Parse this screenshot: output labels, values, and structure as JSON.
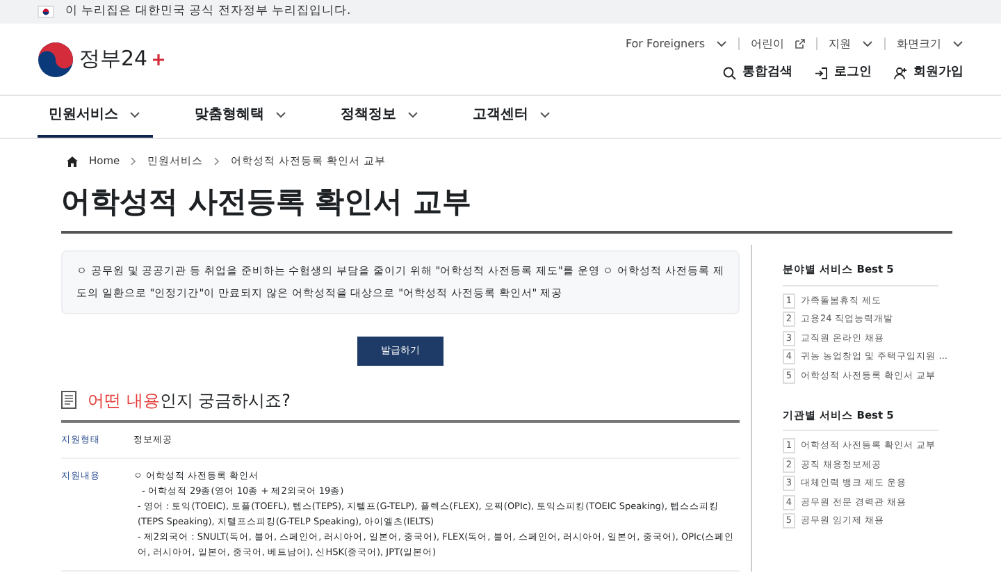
{
  "banner": {
    "text": "이 누리집은 대한민국 공식 전자정부 누리집입니다."
  },
  "header": {
    "logo_text": "정부24",
    "util_links": [
      {
        "label": "For Foreigners",
        "kind": "dropdown"
      },
      {
        "label": "어린이",
        "kind": "external"
      },
      {
        "label": "지원",
        "kind": "dropdown"
      },
      {
        "label": "화면크기",
        "kind": "dropdown"
      }
    ],
    "actions": [
      {
        "label": "통합검색",
        "kind": "search"
      },
      {
        "label": "로그인",
        "kind": "login"
      },
      {
        "label": "회원가입",
        "kind": "join"
      }
    ]
  },
  "nav": [
    {
      "label": "민원서비스",
      "selected": true
    },
    {
      "label": "맞춤형혜택",
      "selected": false
    },
    {
      "label": "정책정보",
      "selected": false
    },
    {
      "label": "고객센터",
      "selected": false
    }
  ],
  "breadcrumb": [
    "Home",
    "민원서비스",
    "어학성적 사전등록 확인서 교부"
  ],
  "title": "어학성적 사전등록 확인서 교부",
  "intro": "ㅇ 공무원 및 공공기관 등 취업을 준비하는 수험생의 부담을 줄이기 위해 \"어학성적 사전등록 제도\"를 운영 ㅇ 어학성적 사전등록 제도의 일환으로 \"인정기간\"이 만료되지 않은 어학성적을 대상으로 \"어학성적 사전등록 확인서\" 제공",
  "apply_button": "발급하기",
  "section": {
    "highlight": "어떤 내용",
    "rest": "인지 궁금하시죠?",
    "rows": [
      {
        "label": "지원형태",
        "lines": [
          {
            "kind": "main",
            "text": "정보제공"
          }
        ]
      },
      {
        "label": "지원내용",
        "lines": [
          {
            "kind": "main",
            "text": "ㅇ 어학성적 사전등록 확인서"
          },
          {
            "kind": "sub",
            "text": "- 어학성적 29종(영어 10종 + 제2외국어 19종)"
          },
          {
            "kind": "item",
            "text": "- 영어 : 토익(TOEIC), 토플(TOEFL), 텝스(TEPS), 지텔프(G-TELP), 플렉스(FLEX), 오픽(OPIc), 토익스피킹(TOEIC Speaking), 텝스스피킹(TEPS Speaking), 지텔프스피킹(G-TELP Speaking), 아이엘츠(IELTS)"
          },
          {
            "kind": "item",
            "text": "- 제2외국어 : SNULT(독어, 불어, 스페인어, 러시아어, 일본어, 중국어), FLEX(독어, 불어, 스페인어, 러시아어, 일본어, 중국어), OPIc(스페인어, 러시아어, 일본어, 중국어, 베트남어), 신HSK(중국어), JPT(일본어)"
          }
        ]
      }
    ]
  },
  "sidebar": [
    {
      "title": "분야별 서비스 Best 5",
      "items": [
        {
          "rank": "1",
          "label": "가족돌봄휴직 제도"
        },
        {
          "rank": "2",
          "label": "고용24 직업능력개발"
        },
        {
          "rank": "3",
          "label": "교직원 온라인 채용"
        },
        {
          "rank": "4",
          "label": "귀농 농업창업 및 주택구입지원 ..."
        },
        {
          "rank": "5",
          "label": "어학성적 사전등록 확인서 교부"
        }
      ]
    },
    {
      "title": "기관별 서비스 Best 5",
      "items": [
        {
          "rank": "1",
          "label": "어학성적 사전등록 확인서 교부"
        },
        {
          "rank": "2",
          "label": "공직 채용정보제공"
        },
        {
          "rank": "3",
          "label": "대체인력 뱅크 제도 운용"
        },
        {
          "rank": "4",
          "label": "공무원 전문 경력관 채용"
        },
        {
          "rank": "5",
          "label": "공무원 임기제 채용"
        }
      ]
    }
  ]
}
